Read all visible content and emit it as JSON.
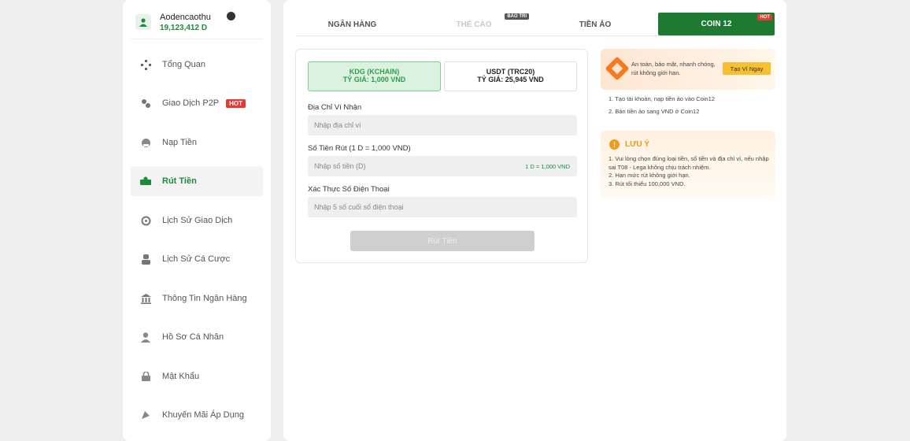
{
  "user": {
    "name": "Aodencaothu",
    "balance": "19,123,412 D"
  },
  "nav": [
    {
      "label": "Tổng Quan",
      "icon": "overview-icon"
    },
    {
      "label": "Giao Dịch P2P",
      "icon": "p2p-icon",
      "badge": "HOT"
    },
    {
      "label": "Nạp Tiền",
      "icon": "deposit-icon"
    },
    {
      "label": "Rút Tiền",
      "icon": "withdraw-icon",
      "active": true
    },
    {
      "label": "Lịch Sử Giao Dịch",
      "icon": "history-icon"
    },
    {
      "label": "Lịch Sử Cá Cược",
      "icon": "bet-history-icon"
    },
    {
      "label": "Thông Tin Ngân Hàng",
      "icon": "bank-icon"
    },
    {
      "label": "Hồ Sơ Cá Nhân",
      "icon": "profile-icon"
    },
    {
      "label": "Mật Khẩu",
      "icon": "lock-icon"
    },
    {
      "label": "Khuyến Mãi Áp Dụng",
      "icon": "promo-icon"
    }
  ],
  "tabs": [
    {
      "label": "NGÂN HÀNG"
    },
    {
      "label": "THẺ CÀO",
      "badge": "BẢO TRÌ",
      "disabled": true
    },
    {
      "label": "TIỀN ẢO"
    },
    {
      "label": "COIN 12",
      "badge": "HOT",
      "active": true
    }
  ],
  "coins": [
    {
      "name": "KDG (KCHAIN)",
      "rate": "TỶ GIÁ: 1,000 VND",
      "selected": true
    },
    {
      "name": "USDT (TRC20)",
      "rate": "TỶ GIÁ: 25,945 VND",
      "selected": false
    }
  ],
  "form": {
    "address_label": "Địa Chỉ Ví Nhận",
    "address_placeholder": "Nhập địa chỉ ví",
    "amount_label": "Số Tiền Rút (1 D = 1,000 VND)",
    "amount_placeholder": "Nhập số tiền (D)",
    "amount_hint": "1 D = 1,000 VND",
    "phone_label": "Xác Thực Số Điện Thoại",
    "phone_placeholder": "Nhập 5 số cuối số điện thoại",
    "submit_label": "Rút Tiền"
  },
  "promo": {
    "text": "An toàn, bảo mật, nhanh chóng, rút không giới hạn.",
    "button": "Tạo Ví Ngay",
    "steps": [
      "1. Tạo tài khoản, nạp tiền ảo vào Coin12",
      "2. Bán tiền ảo sang VND ở Coin12"
    ]
  },
  "note": {
    "title": "LƯU Ý",
    "items": [
      "1. Vui lòng chọn đúng loại tiền, số tiền và địa chỉ ví, nếu nhập sai T08 - Lega không chịu trách nhiệm.",
      "2. Hạn mức rút không giới hạn.",
      "3. Rút tối thiểu 100,000 VND."
    ]
  },
  "colors": {
    "accent": "#1f7a31",
    "hot": "#e53935",
    "warning": "#f29a1f"
  }
}
